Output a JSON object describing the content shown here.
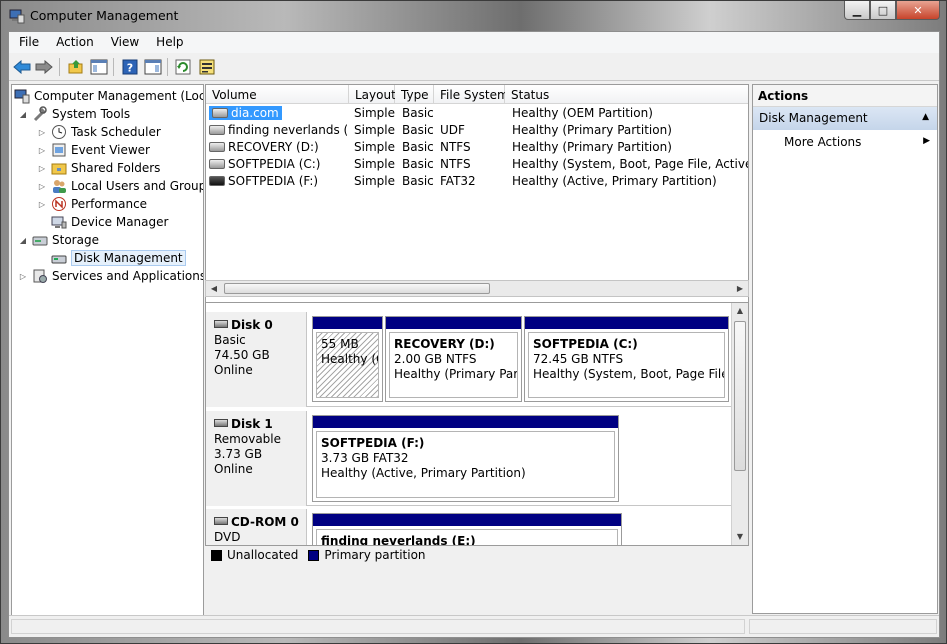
{
  "window": {
    "title": "Computer Management"
  },
  "menu": [
    "File",
    "Action",
    "View",
    "Help"
  ],
  "tree": [
    {
      "label": "Computer Management (Local",
      "level": 0,
      "twisty": "",
      "icon": "computer-management-icon"
    },
    {
      "label": "System Tools",
      "level": 1,
      "twisty": "◢",
      "icon": "system-tools-icon"
    },
    {
      "label": "Task Scheduler",
      "level": 2,
      "twisty": "▷",
      "icon": "clock-icon"
    },
    {
      "label": "Event Viewer",
      "level": 2,
      "twisty": "▷",
      "icon": "event-viewer-icon"
    },
    {
      "label": "Shared Folders",
      "level": 2,
      "twisty": "▷",
      "icon": "shared-folder-icon"
    },
    {
      "label": "Local Users and Groups",
      "level": 2,
      "twisty": "▷",
      "icon": "users-icon"
    },
    {
      "label": "Performance",
      "level": 2,
      "twisty": "▷",
      "icon": "performance-icon"
    },
    {
      "label": "Device Manager",
      "level": 2,
      "twisty": "",
      "icon": "device-manager-icon"
    },
    {
      "label": "Storage",
      "level": 1,
      "twisty": "◢",
      "icon": "storage-icon"
    },
    {
      "label": "Disk Management",
      "level": 2,
      "twisty": "",
      "icon": "disk-management-icon",
      "selected": true
    },
    {
      "label": "Services and Applications",
      "level": 1,
      "twisty": "▷",
      "icon": "services-icon"
    }
  ],
  "volumes": {
    "columns": [
      "Volume",
      "Layout",
      "Type",
      "File System",
      "Status"
    ],
    "rows": [
      {
        "volume": "dia.com",
        "layout": "Simple",
        "type": "Basic",
        "fs": "",
        "status": "Healthy (OEM Partition)",
        "selected": true
      },
      {
        "volume": "finding neverlands (E:)",
        "layout": "Simple",
        "type": "Basic",
        "fs": "UDF",
        "status": "Healthy (Primary Partition)"
      },
      {
        "volume": "RECOVERY (D:)",
        "layout": "Simple",
        "type": "Basic",
        "fs": "NTFS",
        "status": "Healthy (Primary Partition)"
      },
      {
        "volume": "SOFTPEDIA (C:)",
        "layout": "Simple",
        "type": "Basic",
        "fs": "NTFS",
        "status": "Healthy (System, Boot, Page File, Active, Cras"
      },
      {
        "volume": "SOFTPEDIA (F:)",
        "layout": "Simple",
        "type": "Basic",
        "fs": "FAT32",
        "status": "Healthy (Active, Primary Partition)"
      }
    ]
  },
  "disks": [
    {
      "name": "Disk 0",
      "kind": "Basic",
      "size": "74.50 GB",
      "state": "Online",
      "partitions": [
        {
          "title": "",
          "size": "55 MB",
          "status": "Healthy (O",
          "hatched": true
        },
        {
          "title": "RECOVERY  (D:)",
          "size": "2.00 GB NTFS",
          "status": "Healthy (Primary Partiti"
        },
        {
          "title": "SOFTPEDIA  (C:)",
          "size": "72.45 GB NTFS",
          "status": "Healthy (System, Boot, Page File, Ac"
        }
      ]
    },
    {
      "name": "Disk 1",
      "kind": "Removable",
      "size": "3.73 GB",
      "state": "Online",
      "partitions": [
        {
          "title": "SOFTPEDIA  (F:)",
          "size": "3.73 GB FAT32",
          "status": "Healthy (Active, Primary Partition)"
        }
      ]
    },
    {
      "name": "CD-ROM 0",
      "kind": "DVD",
      "partitions": [
        {
          "title": "finding neverlands  (E:)"
        }
      ]
    }
  ],
  "legend": [
    {
      "label": "Unallocated",
      "color": "#000000"
    },
    {
      "label": "Primary partition",
      "color": "#000082"
    }
  ],
  "actions": {
    "title": "Actions",
    "section": "Disk Management",
    "items": [
      "More Actions"
    ]
  }
}
